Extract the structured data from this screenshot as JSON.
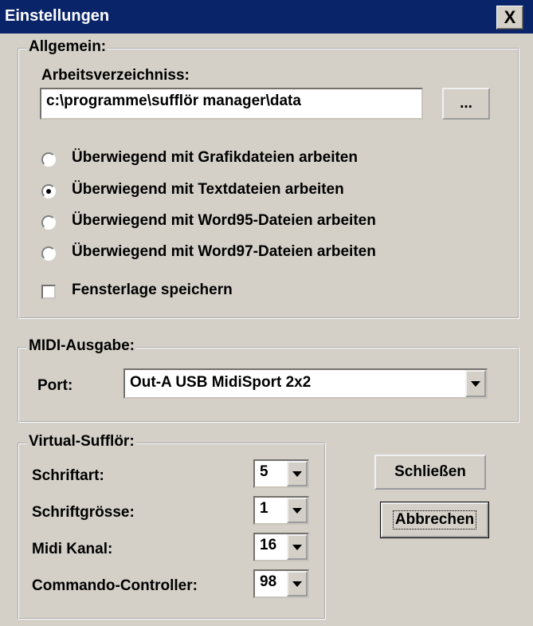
{
  "window": {
    "title": "Einstellungen",
    "close_label": "X"
  },
  "allgemein": {
    "label": "Allgemein:",
    "workdir_label": "Arbeitsverzeichniss:",
    "workdir_value": "c:\\programme\\sufflör manager\\data",
    "browse_label": "...",
    "radios": [
      {
        "label": "Überwiegend mit Grafikdateien arbeiten",
        "selected": false
      },
      {
        "label": "Überwiegend mit Textdateien arbeiten",
        "selected": true
      },
      {
        "label": "Überwiegend mit Word95-Dateien arbeiten",
        "selected": false
      },
      {
        "label": "Überwiegend mit Word97-Dateien arbeiten",
        "selected": false
      }
    ],
    "checkbox_label": "Fensterlage speichern",
    "checkbox_checked": false
  },
  "midi": {
    "label": "MIDI-Ausgabe:",
    "port_label": "Port:",
    "port_value": "Out-A USB MidiSport 2x2"
  },
  "virtual": {
    "label": "Virtual-Sufflör:",
    "rows": [
      {
        "label": "Schriftart:",
        "value": "5"
      },
      {
        "label": "Schriftgrösse:",
        "value": "1"
      },
      {
        "label": "Midi Kanal:",
        "value": "16"
      },
      {
        "label": "Commando-Controller:",
        "value": "98"
      }
    ]
  },
  "buttons": {
    "close": "Schließen",
    "cancel": "Abbrechen"
  },
  "colors": {
    "titlebar": "#0a246a",
    "face": "#d4d0c8"
  }
}
